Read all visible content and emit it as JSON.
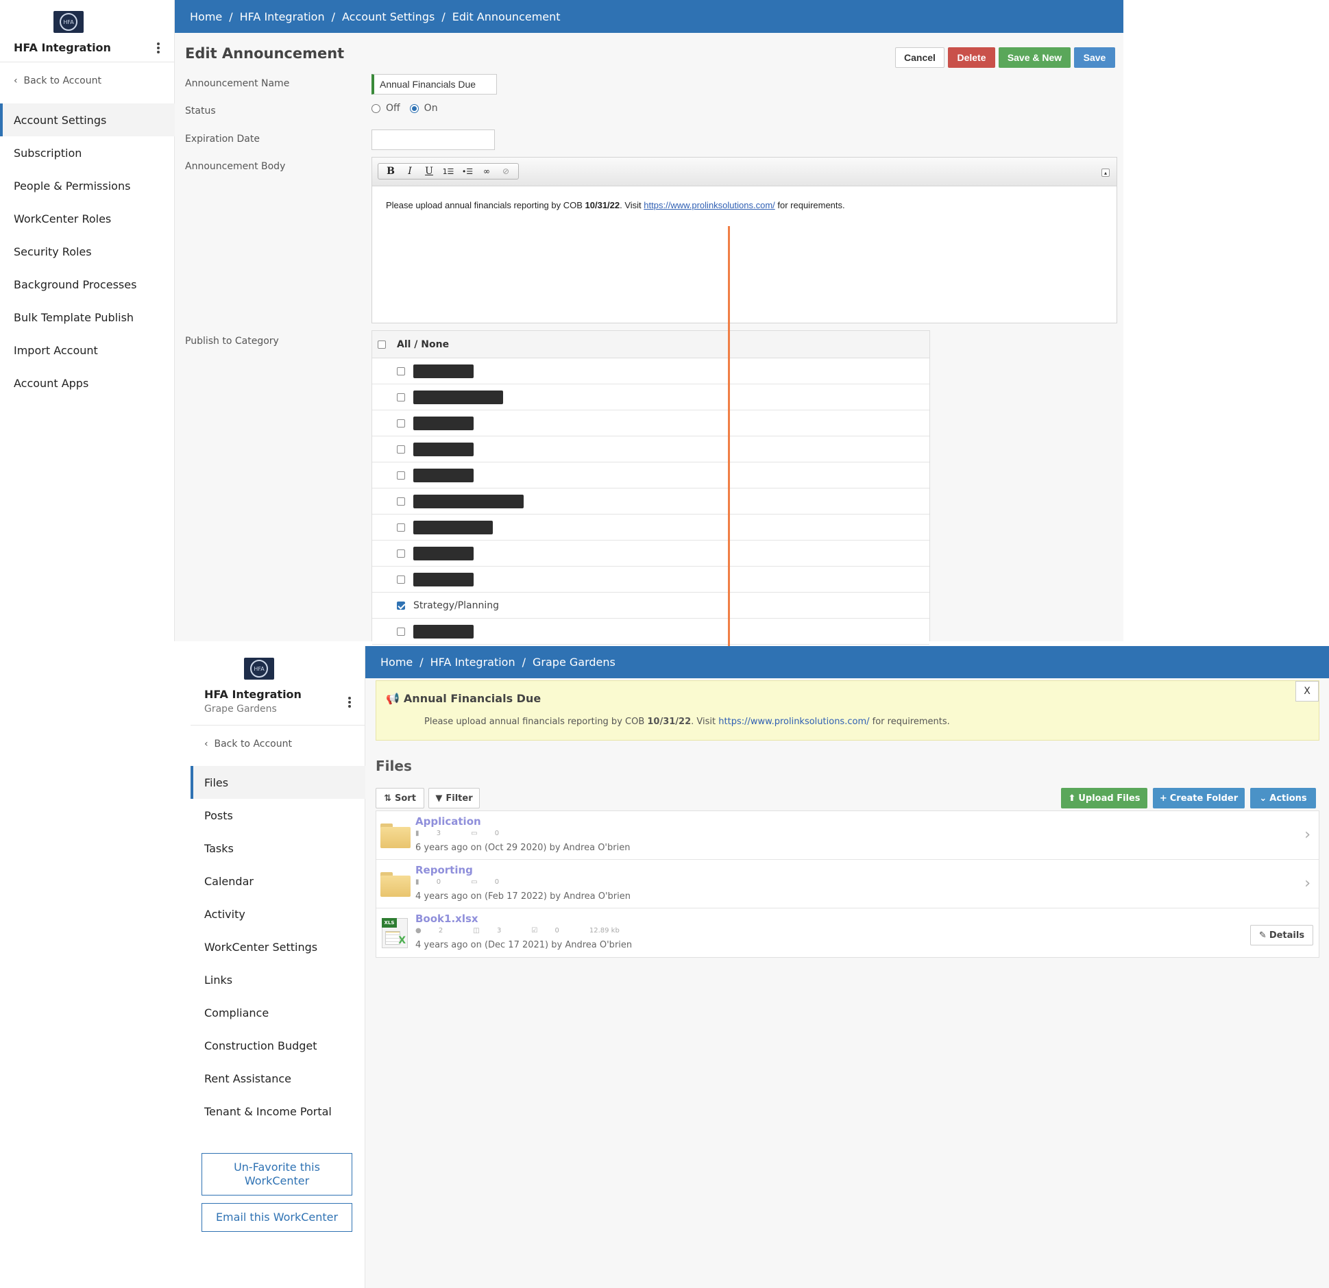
{
  "top": {
    "sidebar": {
      "org_title": "HFA Integration",
      "back_label": "Back to Account",
      "items": [
        "Account Settings",
        "Subscription",
        "People & Permissions",
        "WorkCenter Roles",
        "Security Roles",
        "Background Processes",
        "Bulk Template Publish",
        "Import Account",
        "Account Apps"
      ]
    },
    "breadcrumb": [
      "Home",
      "HFA Integration",
      "Account Settings",
      "Edit Announcement"
    ],
    "page_title": "Edit Announcement",
    "buttons": {
      "cancel": "Cancel",
      "delete": "Delete",
      "save_new": "Save & New",
      "save": "Save"
    },
    "form": {
      "name_label": "Announcement Name",
      "name_value": "Annual Financials Due",
      "status_label": "Status",
      "status_off": "Off",
      "status_on": "On",
      "status_selected": "On",
      "expiration_label": "Expiration Date",
      "expiration_value": "",
      "body_label": "Announcement Body",
      "body_pre": "Please upload annual financials reporting by COB ",
      "body_bold": "10/31/22",
      "body_mid": ". Visit ",
      "body_link": "https://www.prolinksolutions.com/",
      "body_post": " for requirements.",
      "publish_label": "Publish to Category"
    },
    "editor_toolbar": [
      "B",
      "I",
      "U",
      "ordered-list-icon",
      "unordered-list-icon",
      "link-icon",
      "unlink-icon"
    ],
    "categories": {
      "header": "All / None",
      "rows": [
        {
          "label": "[redacted]",
          "redacted": true,
          "checked": false
        },
        {
          "label": "[redacted]",
          "redacted": true,
          "checked": false
        },
        {
          "label": "[redacted]",
          "redacted": true,
          "checked": false
        },
        {
          "label": "[redacted]",
          "redacted": true,
          "checked": false
        },
        {
          "label": "[redacted]",
          "redacted": true,
          "checked": false
        },
        {
          "label": "[redacted]",
          "redacted": true,
          "checked": false
        },
        {
          "label": "[redacted]",
          "redacted": true,
          "checked": false
        },
        {
          "label": "[redacted]",
          "redacted": true,
          "checked": false
        },
        {
          "label": "[redacted]",
          "redacted": true,
          "checked": false
        },
        {
          "label": "Strategy/Planning",
          "redacted": false,
          "checked": true
        },
        {
          "label": "[redacted]",
          "redacted": true,
          "checked": false
        }
      ]
    }
  },
  "bottom": {
    "sidebar": {
      "org_title": "HFA Integration",
      "org_subtitle": "Grape Gardens",
      "back_label": "Back to Account",
      "items": [
        "Files",
        "Posts",
        "Tasks",
        "Calendar",
        "Activity",
        "WorkCenter Settings",
        "Links",
        "Compliance",
        "Construction Budget",
        "Rent Assistance",
        "Tenant & Income Portal"
      ],
      "unfavorite_label": "Un-Favorite this WorkCenter",
      "email_label": "Email this WorkCenter"
    },
    "breadcrumb": [
      "Home",
      "HFA Integration",
      "Grape Gardens"
    ],
    "banner": {
      "title": "Annual Financials Due",
      "text_pre": "Please upload annual financials reporting by COB ",
      "text_bold": "10/31/22",
      "text_mid": ". Visit ",
      "text_link": "https://www.prolinksolutions.com/",
      "text_post": " for requirements.",
      "close": "X"
    },
    "files_title": "Files",
    "toolbar": {
      "sort": "Sort",
      "filter": "Filter",
      "upload": "Upload Files",
      "create": "Create Folder",
      "actions": "Actions"
    },
    "files": [
      {
        "name": "Application",
        "type": "folder",
        "meta": [
          "3",
          "0"
        ],
        "date": "6 years ago on (Oct 29 2020) by Andrea O'brien"
      },
      {
        "name": "Reporting",
        "type": "folder",
        "meta": [
          "0",
          "0"
        ],
        "date": "4 years ago on (Feb 17 2022) by Andrea O'brien"
      },
      {
        "name": "Book1.xlsx",
        "type": "xlsx",
        "meta": [
          "2",
          "3",
          "0",
          "12.89 kb"
        ],
        "date": "4 years ago on (Dec 17 2021) by Andrea O'brien",
        "details": "Details"
      }
    ],
    "colors": {
      "primary": "#2f72b3",
      "green": "#5aa75a",
      "banner": "#fafad0",
      "delete": "#c9514a",
      "arrow": "#f07f46"
    }
  }
}
